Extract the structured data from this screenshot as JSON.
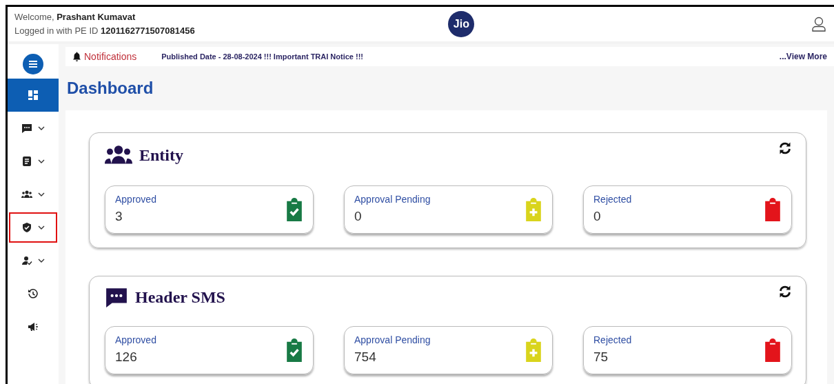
{
  "header": {
    "welcome_label": "Welcome,",
    "user_name": "Prashant Kumavat",
    "login_label": "Logged in with PE ID",
    "pe_id": "1201162771507081456",
    "logo_text": "Jio"
  },
  "sidebar": {
    "items": [
      {
        "kind": "dashboard",
        "dropdown": false,
        "selected": true,
        "highlighted": false
      },
      {
        "kind": "chat",
        "dropdown": true,
        "selected": false,
        "highlighted": false
      },
      {
        "kind": "document",
        "dropdown": true,
        "selected": false,
        "highlighted": false
      },
      {
        "kind": "people",
        "dropdown": true,
        "selected": false,
        "highlighted": false
      },
      {
        "kind": "shield",
        "dropdown": true,
        "selected": false,
        "highlighted": true
      },
      {
        "kind": "user-check",
        "dropdown": true,
        "selected": false,
        "highlighted": false
      },
      {
        "kind": "history",
        "dropdown": false,
        "selected": false,
        "highlighted": false
      },
      {
        "kind": "megaphone",
        "dropdown": false,
        "selected": false,
        "highlighted": false
      }
    ]
  },
  "notifications": {
    "label": "Notifications",
    "message": "Published Date - 28-08-2024 !!! Important TRAI Notice !!!",
    "view_more": "...View More"
  },
  "page_title": "Dashboard",
  "cards": [
    {
      "title": "Entity",
      "kind": "people",
      "stats": [
        {
          "label": "Approved",
          "value": "3",
          "kind": "approved",
          "color": "#187a45"
        },
        {
          "label": "Approval Pending",
          "value": "0",
          "kind": "pending",
          "color": "#d9d41c"
        },
        {
          "label": "Rejected",
          "value": "0",
          "kind": "rejected",
          "color": "#e3141b"
        }
      ]
    },
    {
      "title": "Header SMS",
      "kind": "chat",
      "stats": [
        {
          "label": "Approved",
          "value": "126",
          "kind": "approved",
          "color": "#187a45"
        },
        {
          "label": "Approval Pending",
          "value": "754",
          "kind": "pending",
          "color": "#d9d41c"
        },
        {
          "label": "Rejected",
          "value": "75",
          "kind": "rejected",
          "color": "#e3141b"
        }
      ]
    }
  ]
}
